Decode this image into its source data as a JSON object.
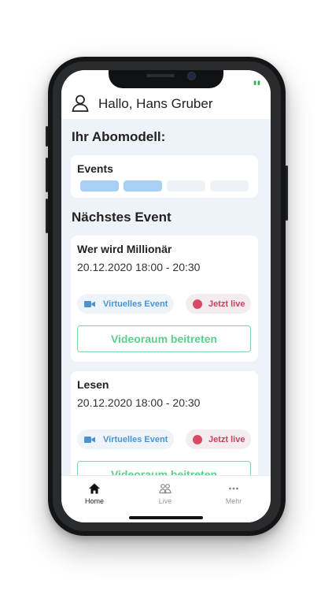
{
  "header": {
    "greeting": "Hallo, Hans Gruber"
  },
  "subscription": {
    "section_title": "Ihr Abomodell:",
    "card_label": "Events",
    "segments_filled": 2,
    "segments_total": 4,
    "colors": {
      "filled": "#a7d0f5",
      "empty": "#eef1f5"
    }
  },
  "next_event": {
    "section_title": "Nächstes Event",
    "events": [
      {
        "title": "Wer wird Millionär",
        "date": "20.12.2020 18:00 - 20:30",
        "type_label": "Virtuelles Event",
        "status_label": "Jetzt live",
        "join_label": "Videoraum beitreten"
      },
      {
        "title": "Lesen",
        "date": "20.12.2020 18:00 - 20:30",
        "type_label": "Virtuelles Event",
        "status_label": "Jetzt live",
        "join_label": "Videoraum beitreten"
      }
    ]
  },
  "tabbar": {
    "items": [
      {
        "label": "Home",
        "icon": "home-icon",
        "active": true
      },
      {
        "label": "Live",
        "icon": "people-icon",
        "active": false
      },
      {
        "label": "Mehr",
        "icon": "more-icon",
        "active": false
      }
    ]
  },
  "colors": {
    "background": "#edf3f8",
    "virtual_chip": "#4a93d1",
    "live_chip": "#c8415f",
    "join_button": "#5ccf8f"
  }
}
